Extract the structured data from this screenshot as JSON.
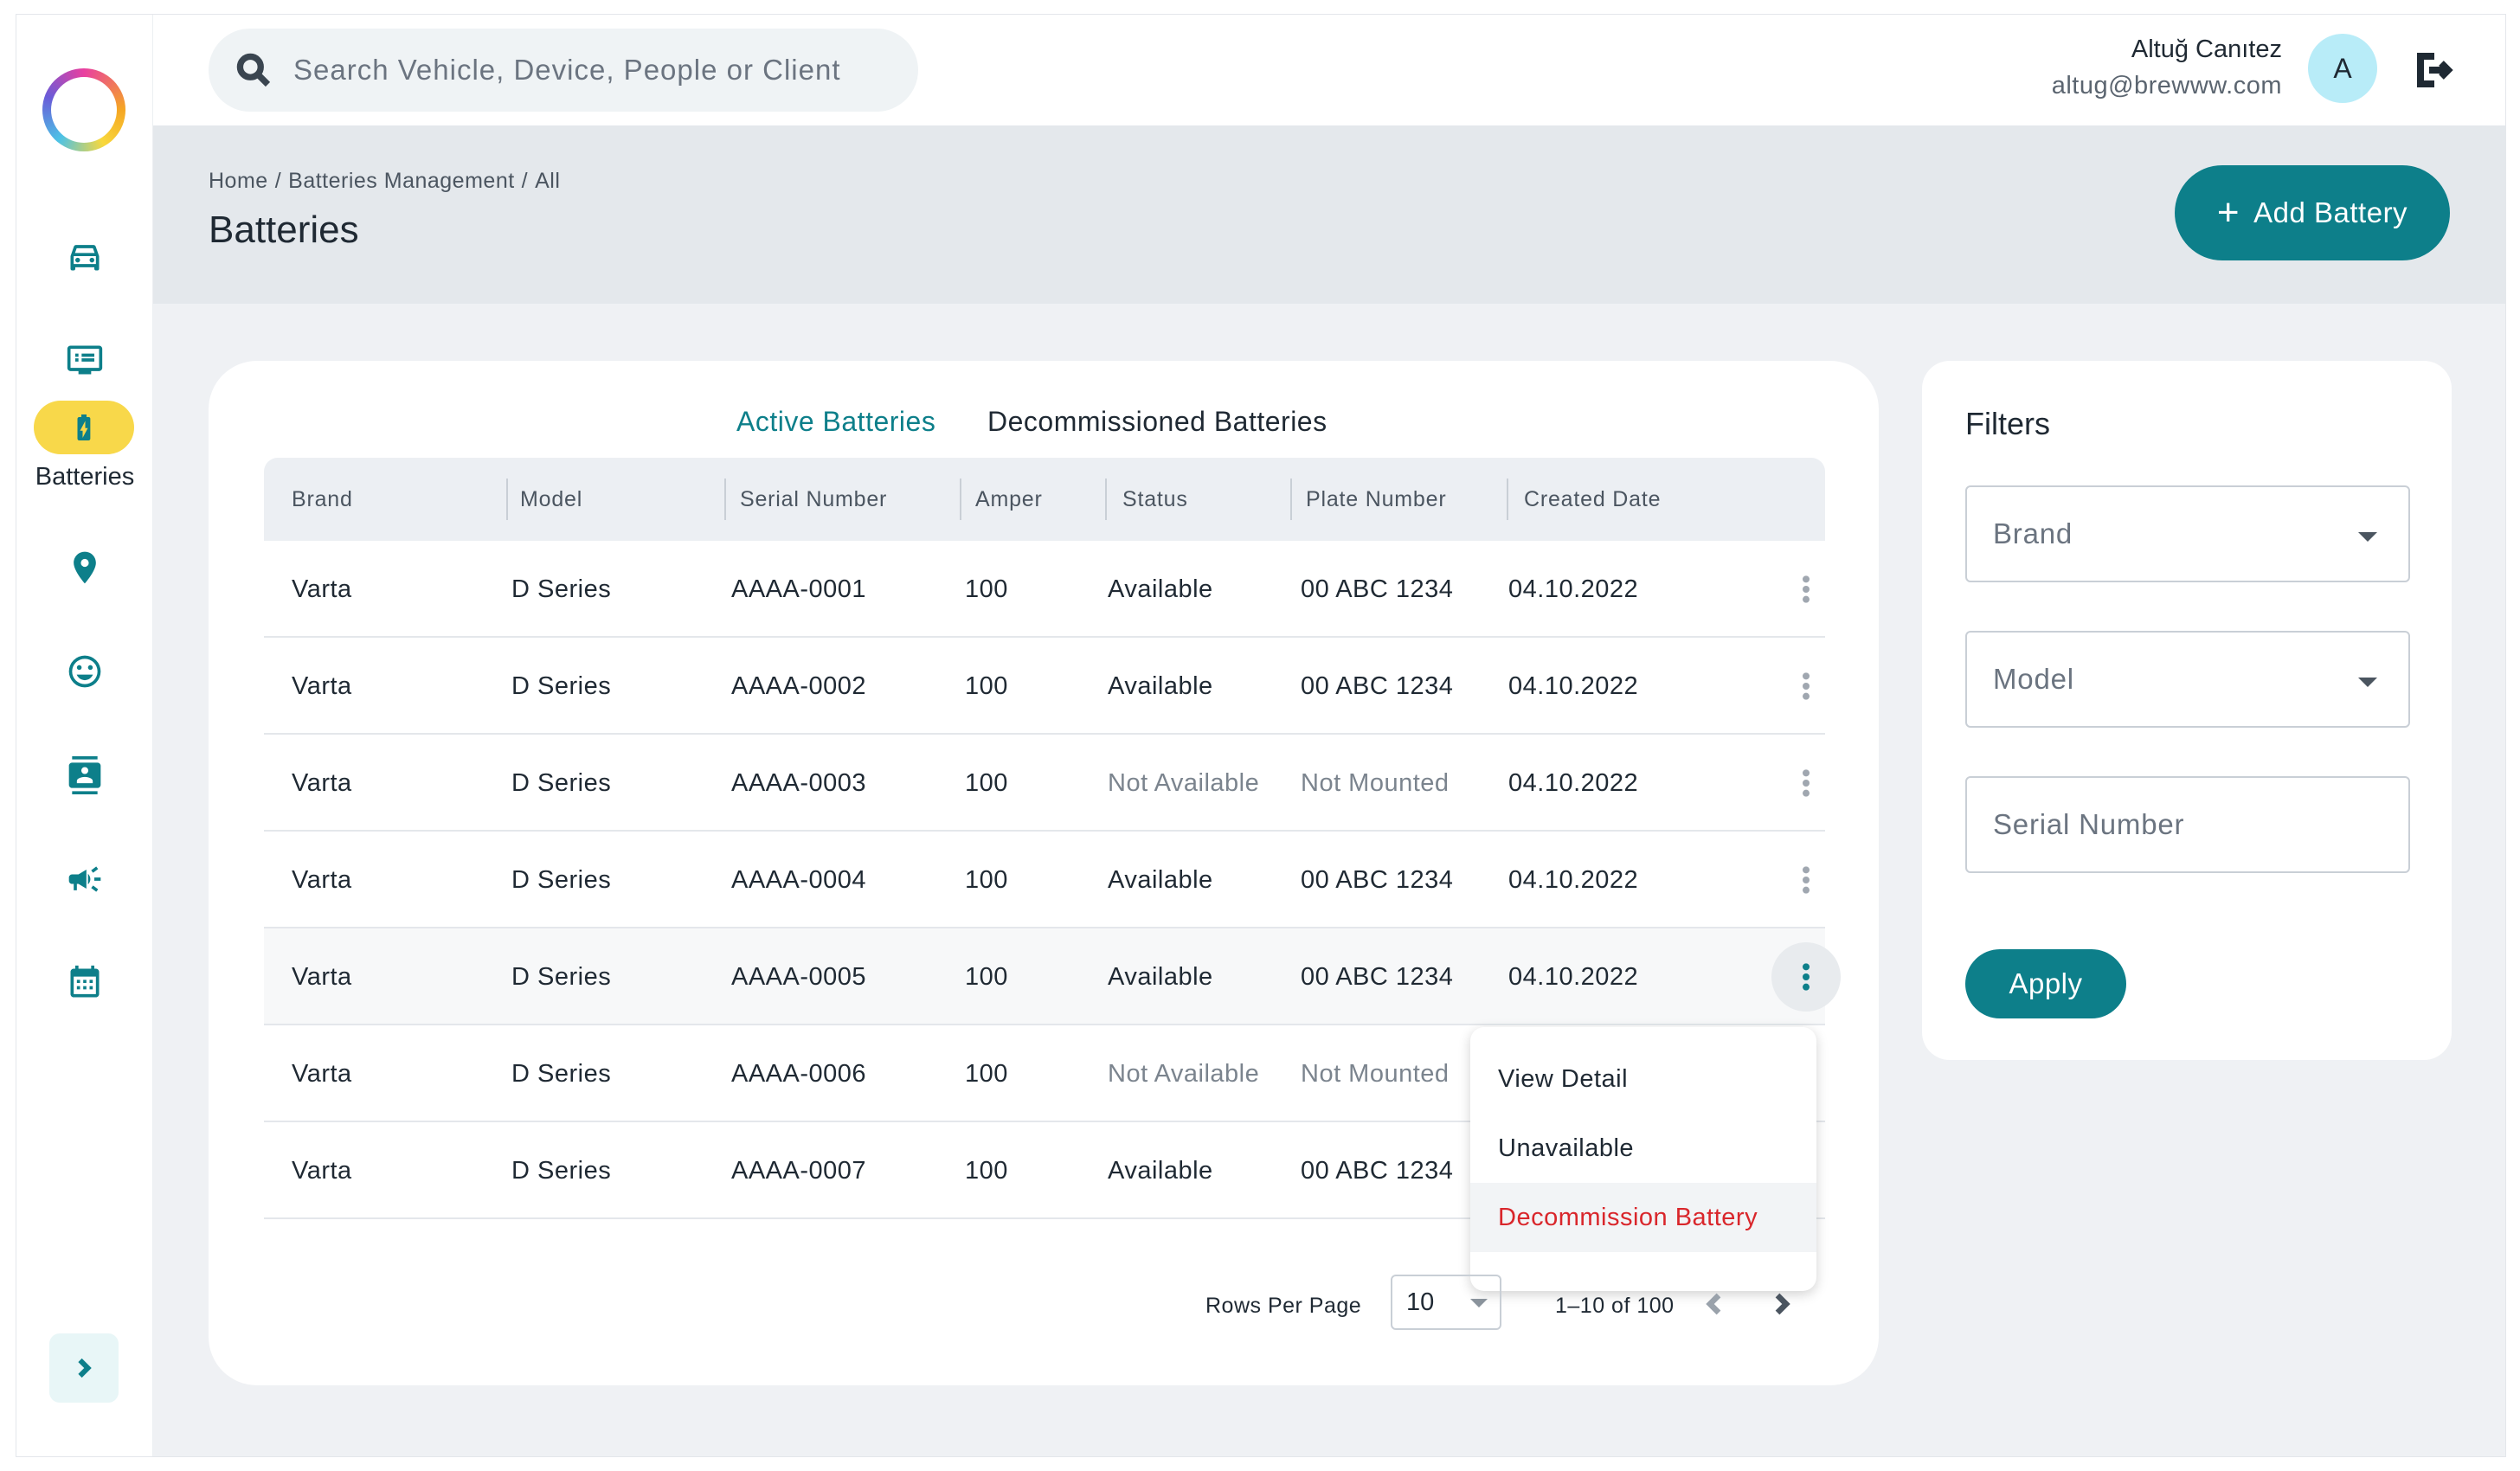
{
  "search": {
    "placeholder": "Search Vehicle, Device, People or Client"
  },
  "user": {
    "name": "Altuğ Canıtez",
    "email": "altug@brewww.com",
    "avatar_letter": "A"
  },
  "sidebar": {
    "items": [
      {
        "icon": "car-icon"
      },
      {
        "icon": "list-icon"
      },
      {
        "icon": "battery-icon",
        "label": "Batteries",
        "active": true
      },
      {
        "icon": "location-pin-icon"
      },
      {
        "icon": "smiley-icon"
      },
      {
        "icon": "contact-card-icon"
      },
      {
        "icon": "megaphone-icon"
      },
      {
        "icon": "calendar-icon"
      }
    ]
  },
  "breadcrumb": {
    "home": "Home",
    "section": "Batteries Management",
    "current": "All",
    "separator": "/"
  },
  "page": {
    "title": "Batteries",
    "add_button": "Add Battery"
  },
  "tabs": {
    "active": "Active Batteries",
    "inactive": "Decommissioned Batteries"
  },
  "table": {
    "headers": [
      "Brand",
      "Model",
      "Serial Number",
      "Amper",
      "Status",
      "Plate Number",
      "Created Date"
    ],
    "rows": [
      {
        "brand": "Varta",
        "model": "D Series",
        "serial": "AAAA-0001",
        "amper": "100",
        "status": "Available",
        "plate": "00 ABC 1234",
        "date": "04.10.2022",
        "muted": false
      },
      {
        "brand": "Varta",
        "model": "D Series",
        "serial": "AAAA-0002",
        "amper": "100",
        "status": "Available",
        "plate": "00 ABC 1234",
        "date": "04.10.2022",
        "muted": false
      },
      {
        "brand": "Varta",
        "model": "D Series",
        "serial": "AAAA-0003",
        "amper": "100",
        "status": "Not Available",
        "plate": "Not Mounted",
        "date": "04.10.2022",
        "muted": true
      },
      {
        "brand": "Varta",
        "model": "D Series",
        "serial": "AAAA-0004",
        "amper": "100",
        "status": "Available",
        "plate": "00 ABC 1234",
        "date": "04.10.2022",
        "muted": false
      },
      {
        "brand": "Varta",
        "model": "D Series",
        "serial": "AAAA-0005",
        "amper": "100",
        "status": "Available",
        "plate": "00 ABC 1234",
        "date": "04.10.2022",
        "muted": false
      },
      {
        "brand": "Varta",
        "model": "D Series",
        "serial": "AAAA-0006",
        "amper": "100",
        "status": "Not Available",
        "plate": "Not Mounted",
        "date": "",
        "muted": true
      },
      {
        "brand": "Varta",
        "model": "D Series",
        "serial": "AAAA-0007",
        "amper": "100",
        "status": "Available",
        "plate": "00 ABC 1234",
        "date": "",
        "muted": false
      }
    ]
  },
  "row_menu": {
    "items": [
      "View Detail",
      "Unavailable",
      "Decommission Battery"
    ]
  },
  "pagination": {
    "rows_per_page_label": "Rows Per Page",
    "rows_per_page_value": "10",
    "range": "1–10 of 100"
  },
  "filters": {
    "title": "Filters",
    "brand_placeholder": "Brand",
    "model_placeholder": "Model",
    "serial_placeholder": "Serial Number",
    "apply_label": "Apply"
  },
  "colors": {
    "primary": "#0d7f8a",
    "accent_yellow": "#f8d84a",
    "danger": "#d9262b"
  }
}
